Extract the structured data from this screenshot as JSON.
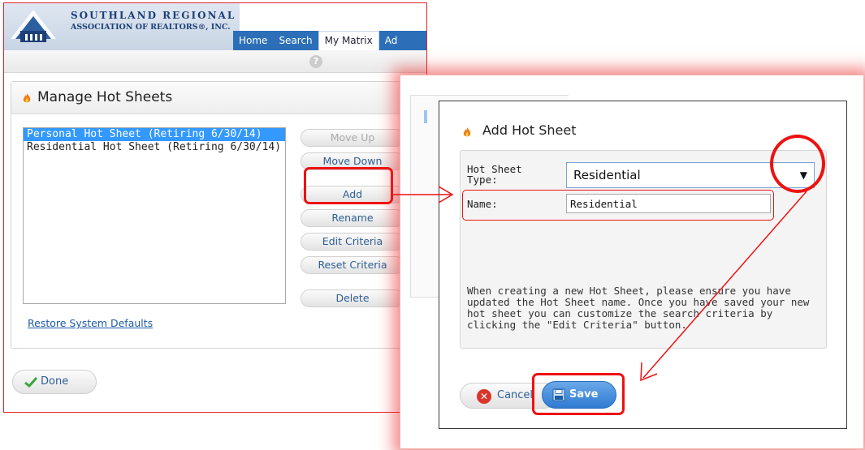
{
  "header": {
    "logo_line1": "SOUTHLAND REGIONAL",
    "logo_line2": "ASSOCIATION OF REALTORS®, INC.",
    "nav_tabs": [
      "Home",
      "Search",
      "My Matrix",
      "Ad"
    ]
  },
  "manage": {
    "title": "Manage Hot Sheets",
    "list": [
      "Personal Hot Sheet (Retiring 6/30/14)",
      "Residential Hot Sheet (Retiring 6/30/14)"
    ],
    "buttons": {
      "move_up": "Move Up",
      "move_down": "Move Down",
      "add": "Add",
      "rename": "Rename",
      "edit_criteria": "Edit Criteria",
      "reset_criteria": "Reset Criteria",
      "delete": "Delete"
    },
    "restore_link": "Restore System Defaults",
    "done": "Done"
  },
  "dialog": {
    "title": "Add Hot Sheet",
    "type_label": "Hot Sheet Type:",
    "type_value": "Residential",
    "name_label": "Name:",
    "name_value": "Residential",
    "info": "When creating a new Hot Sheet, please ensure you have updated the Hot Sheet name. Once you have saved your new hot sheet you can customize the search criteria by clicking the \"Edit Criteria\" button.",
    "cancel": "Cancel",
    "save": "Save"
  },
  "colors": {
    "highlight": "#e11111",
    "nav_blue": "#2c6fb8",
    "link_blue": "#1e5aa8",
    "selection": "#3399ff"
  }
}
